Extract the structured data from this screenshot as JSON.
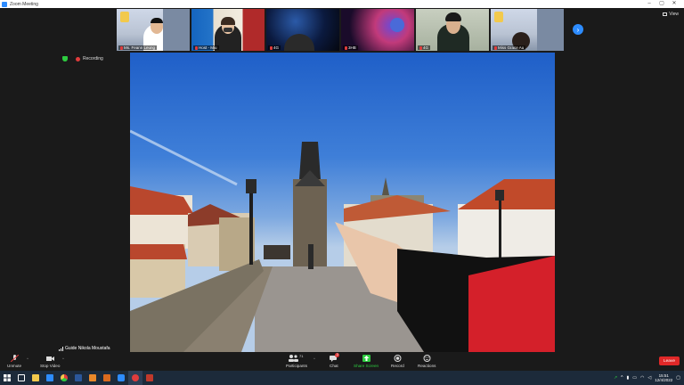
{
  "window": {
    "title": "Zoom Meeting",
    "minimize": "–",
    "maximize": "▢",
    "close": "✕"
  },
  "view": {
    "label": "View"
  },
  "gallery": [
    {
      "name": "Ms. Feann Leung",
      "muted": true
    },
    {
      "name": "Host - Miu",
      "muted": true
    },
    {
      "name": "4G",
      "muted": true
    },
    {
      "name": "3HB",
      "muted": true
    },
    {
      "name": "4G",
      "muted": true
    },
    {
      "name": "Miss Grace Au",
      "muted": true
    }
  ],
  "recording": {
    "label": "Recording"
  },
  "speaker": {
    "name": "Guide Nikola Moustafa"
  },
  "toolbar": {
    "unmute": "Unmute",
    "stop_video": "Stop Video",
    "participants": "Participants",
    "participants_count": "71",
    "chat": "Chat",
    "chat_badge": "2",
    "share": "Share Screen",
    "record": "Record",
    "reactions": "Reactions",
    "leave": "Leave"
  },
  "taskbar": {
    "time": "15:51",
    "date": "12/4/2022"
  },
  "colors": {
    "accent": "#2d8cff",
    "leave": "#e02828",
    "share": "#2ecc40",
    "recording": "#e03c3c"
  }
}
